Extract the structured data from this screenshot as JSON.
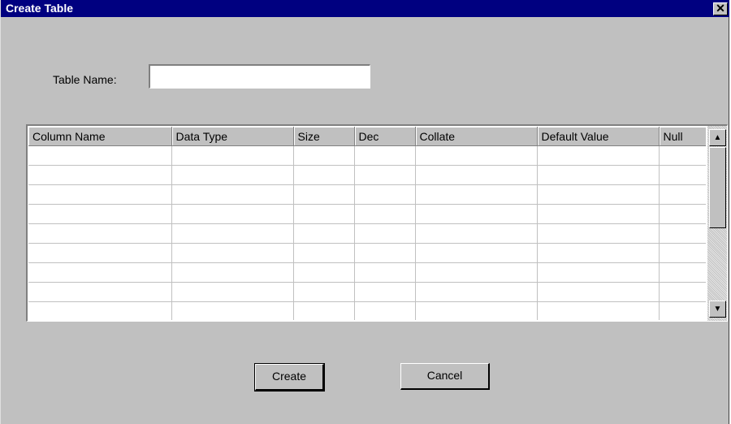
{
  "window": {
    "title": "Create Table",
    "close_glyph": "✕"
  },
  "form": {
    "table_name_label": "Table Name:",
    "table_name_value": "",
    "table_name_placeholder": ""
  },
  "grid": {
    "columns": [
      "Column Name",
      "Data Type",
      "Size",
      "Dec",
      "Collate",
      "Default Value",
      "Null"
    ],
    "row_count": 9
  },
  "scrollbar": {
    "up_glyph": "▲",
    "down_glyph": "▼"
  },
  "buttons": {
    "create_label": "Create",
    "cancel_label": "Cancel"
  },
  "icons": {
    "close": "close-icon",
    "scroll_up": "scroll-up-arrow-icon",
    "scroll_down": "scroll-down-arrow-icon"
  },
  "colors": {
    "titlebar": "#000080",
    "dialog_bg": "#c0c0c0"
  }
}
